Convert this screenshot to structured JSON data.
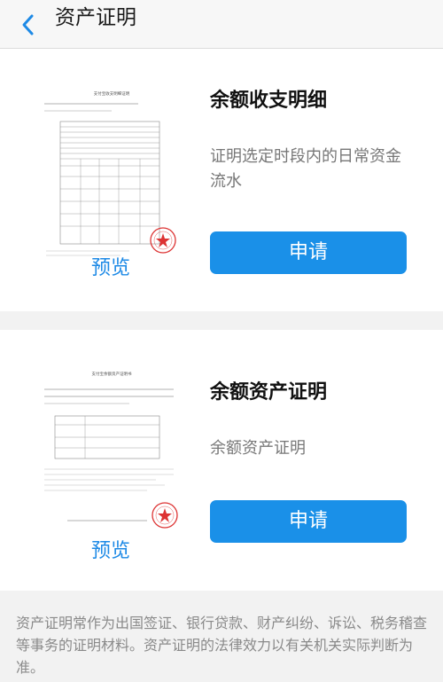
{
  "nav": {
    "title": "资产证明",
    "back_icon": "chevron-left-icon"
  },
  "accent_color": "#1a90e8",
  "cards": [
    {
      "doc_title": "支付宝收支明细证明",
      "title": "余额收支明细",
      "description": "证明选定时段内的日常资金流水",
      "preview_label": "预览",
      "apply_label": "申请"
    },
    {
      "doc_title": "支付宝余额资产证明书",
      "title": "余额资产证明",
      "description": "余额资产证明",
      "preview_label": "预览",
      "apply_label": "申请"
    }
  ],
  "footer": {
    "note": "资产证明常作为出国签证、银行贷款、财产纠纷、诉讼、税务稽查等事务的证明材料。资产证明的法律效力以有关机关实际判断为准。"
  }
}
